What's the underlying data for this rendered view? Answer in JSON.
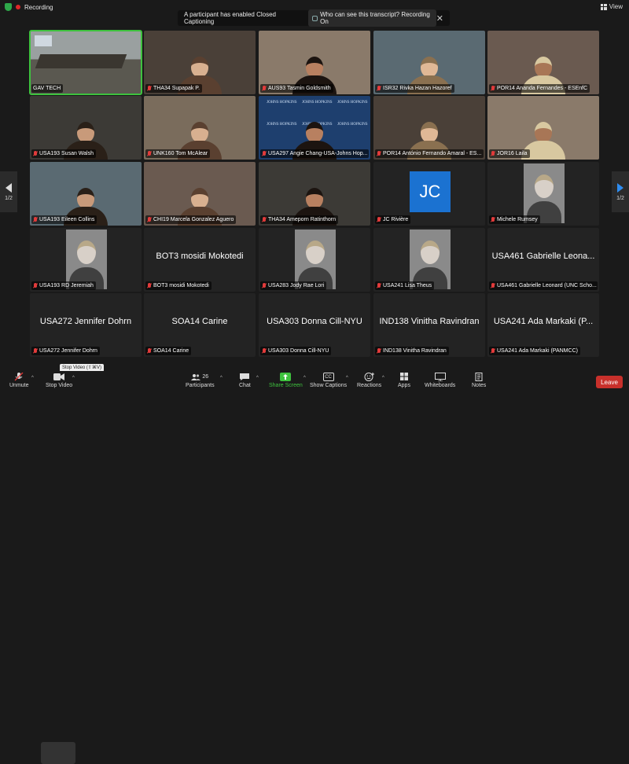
{
  "status": {
    "recording": "Recording",
    "view": "View"
  },
  "banner": {
    "text": "A participant has enabled Closed Captioning",
    "link": "Who can see this transcript? Recording On"
  },
  "pager": {
    "left": "1/2",
    "right": "1/2"
  },
  "participants": [
    {
      "name": "GAV TECH",
      "kind": "room",
      "muted": false,
      "active": true
    },
    {
      "name": "THA34 Supapak P.",
      "kind": "video",
      "muted": true
    },
    {
      "name": "AUS93 Tasmin Goldsmith",
      "kind": "video",
      "muted": true
    },
    {
      "name": "ISR32 Rivka Hazan Hazoref",
      "kind": "video",
      "muted": true
    },
    {
      "name": "POR14 Ananda Fernandes - ESEnfC",
      "kind": "video",
      "muted": true
    },
    {
      "name": "USA193 Susan Walsh",
      "kind": "video",
      "muted": true
    },
    {
      "name": "UNK160 Tom McAlear",
      "kind": "video",
      "muted": true
    },
    {
      "name": "USA297 Angie Chang-USA-Johns Hop...",
      "kind": "video",
      "muted": true,
      "backdrop_text": "JOHNS HOPKINS"
    },
    {
      "name": "POR14 António Fernando Amaral - ES...",
      "kind": "video",
      "muted": true
    },
    {
      "name": "JOR16 Laila",
      "kind": "video",
      "muted": true
    },
    {
      "name": "USA193 Eileen Collins",
      "kind": "video",
      "muted": true
    },
    {
      "name": "CHI19 Marcela Gonzalez Aguero",
      "kind": "video",
      "muted": true
    },
    {
      "name": "THA34 Ameporn Ratinthorn",
      "kind": "video",
      "muted": true
    },
    {
      "name": "JC Rivière",
      "kind": "initials",
      "initials": "JC",
      "muted": true
    },
    {
      "name": "Michele Rumsey",
      "kind": "photo",
      "muted": true
    },
    {
      "name": "USA193 RD Jeremiah",
      "kind": "photo",
      "muted": true
    },
    {
      "name": "BOT3 mosidi Mokotedi",
      "kind": "name",
      "display": "BOT3 mosidi Mokotedi",
      "muted": true
    },
    {
      "name": "USA283 Jody Rae Lori",
      "kind": "photo",
      "muted": true
    },
    {
      "name": "USA241 Lisa Theus",
      "kind": "photo",
      "muted": true
    },
    {
      "name": "USA461 Gabrielle Leonard (UNC Scho...",
      "kind": "name",
      "display": "USA461 Gabrielle Leona...",
      "muted": true
    },
    {
      "name": "USA272 Jennifer Dohrn",
      "kind": "name",
      "display": "USA272 Jennifer Dohrn",
      "muted": true
    },
    {
      "name": "SOA14 Carine",
      "kind": "name",
      "display": "SOA14 Carine",
      "muted": true
    },
    {
      "name": "USA303 Donna Cill-NYU",
      "kind": "name",
      "display": "USA303 Donna Cill-NYU",
      "muted": true
    },
    {
      "name": "IND138 Vinitha Ravindran",
      "kind": "name",
      "display": "IND138 Vinitha Ravindran",
      "muted": true
    },
    {
      "name": "USA241 Ada Markaki (PANMCC)",
      "kind": "name",
      "display": "USA241 Ada Markaki (P...",
      "muted": true
    }
  ],
  "toolbar": {
    "unmute": "Unmute",
    "stop_video": "Stop Video",
    "tooltip": "Stop Video (⇧⌘V)",
    "participants": "Participants",
    "participants_count": "26",
    "chat": "Chat",
    "share_screen": "Share Screen",
    "show_captions": "Show Captions",
    "cc": "CC",
    "reactions": "Reactions",
    "apps": "Apps",
    "whiteboards": "Whiteboards",
    "notes": "Notes",
    "leave": "Leave"
  },
  "colors": {
    "accent_green": "#3ec23e",
    "leave_red": "#c8302b",
    "avatar_blue": "#1b72d1"
  }
}
